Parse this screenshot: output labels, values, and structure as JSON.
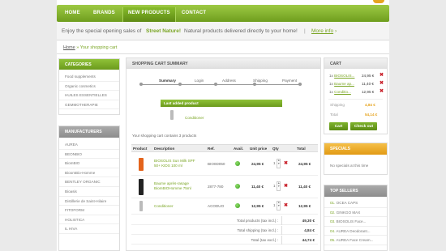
{
  "nav": {
    "items": [
      {
        "label": "HOME",
        "active": false
      },
      {
        "label": "BRANDS",
        "active": false
      },
      {
        "label": "NEW PRODUCTS",
        "active": true
      },
      {
        "label": "CONTACT",
        "active": false
      }
    ]
  },
  "promo": {
    "prefix": "Enjoy the special opening sales of",
    "brand": "Street Nature!",
    "suffix": "Natural products delivered directly to your home!",
    "divider": "|",
    "link": "More info",
    "link_arrow": "›"
  },
  "breadcrumb": {
    "home": "Home",
    "separator": "»",
    "current": "Your shopping cart"
  },
  "categories": {
    "title": "CATEGORIES",
    "items": [
      "Food supplements",
      "Organic cosmetics",
      "HUILES ESSENTIELLES",
      "GEMMOTHERAPIE"
    ]
  },
  "manufacturers": {
    "title": "MANUFACTURERS",
    "items": [
      "AUREA",
      "BEONBIO",
      "BiomBIO",
      "BioomBio-Homme",
      "BENTLEY ORGANIC",
      "Bioasis",
      "Distillerie de Saint-Hilaire",
      "FITOFORM",
      "HOLISTICA",
      "IL HIVA"
    ]
  },
  "summary": {
    "title": "SHOPPING CART SUMMARY",
    "steps": [
      "Summary",
      "Login",
      "Address",
      "Shipping",
      "Payment"
    ],
    "last_added_label": "Last added product",
    "last_added_name": "Conditioner",
    "contains": "Your shopping cart contains 3 products",
    "columns": [
      "Product",
      "Description",
      "Ref.",
      "Avail.",
      "Unit price",
      "Qty",
      "Total"
    ],
    "rows": [
      {
        "description": "BIOSOLIS Sun Milk SPF 50+ KIDS 100 ml",
        "ref": "BIO0D050",
        "unit": "24,95 €",
        "qty": "1",
        "total": "24,95 €"
      },
      {
        "description": "Baume après-rasage BiomBIOHomme 75ml",
        "ref": "2877-780",
        "unit": "11,40 €",
        "qty": "1",
        "total": "11,40 €"
      },
      {
        "description": "Conditioner",
        "ref": "ACODUO",
        "unit": "12,95 €",
        "qty": "1",
        "total": "12,95 €"
      }
    ],
    "totals": [
      {
        "label": "Total products (tax incl.) :",
        "value": "49,30 €"
      },
      {
        "label": "Total shipping (tax incl.) :",
        "value": "4,84 €"
      },
      {
        "label": "Total (tax excl.) :",
        "value": "44,74 €"
      }
    ]
  },
  "cart": {
    "title": "CART",
    "items": [
      {
        "qty": "1x",
        "name": "BIOSOLIS...",
        "price": "24,95 €"
      },
      {
        "qty": "1x",
        "name": "Baume ap...",
        "price": "11,40 €"
      },
      {
        "qty": "1x",
        "name": "Conditio...",
        "price": "12,95 €"
      }
    ],
    "shipping_label": "Shipping",
    "shipping_value": "4,84 €",
    "total_label": "Total",
    "total_value": "54,14 €",
    "cart_button": "Cart",
    "checkout_button": "Check out"
  },
  "specials": {
    "title": "SPECIALS",
    "empty": "No specials at this time"
  },
  "top_sellers": {
    "title": "TOP SELLERS",
    "items": [
      {
        "rank": "01.",
        "name": "OCEA CAPS"
      },
      {
        "rank": "02.",
        "name": "GINKGO MAX"
      },
      {
        "rank": "03.",
        "name": "BIOSOLIS Face..."
      },
      {
        "rank": "04.",
        "name": "AUREA Deodorant..."
      },
      {
        "rank": "05.",
        "name": "AUREA Face Cream..."
      }
    ]
  },
  "colors": {
    "accent": "#7aa524",
    "remove": "#c8202a",
    "specials": "#e6a420"
  },
  "icons": {
    "remove": "close-icon",
    "availability": "in-stock-icon",
    "link_arrow": "chevron-right-icon"
  }
}
